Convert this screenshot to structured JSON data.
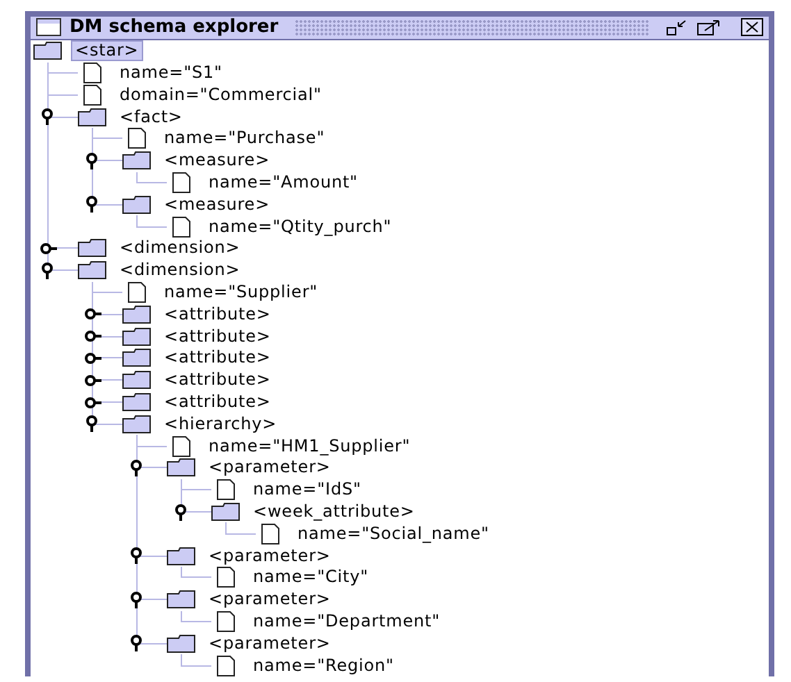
{
  "window": {
    "title": "DM schema explorer"
  },
  "tree": [
    {
      "kind": "element",
      "label": "<star>",
      "selected": true,
      "children": [
        {
          "kind": "value",
          "label": "name=\"S1\"",
          "selected": false
        },
        {
          "kind": "value",
          "label": "domain=\"Commercial\"",
          "selected": false
        },
        {
          "kind": "element",
          "label": "<fact>",
          "selected": false,
          "expanded": true,
          "children": [
            {
              "kind": "value",
              "label": "name=\"Purchase\"",
              "selected": false
            },
            {
              "kind": "element",
              "label": "<measure>",
              "selected": false,
              "expanded": true,
              "children": [
                {
                  "kind": "value",
                  "label": "name=\"Amount\"",
                  "selected": false
                }
              ]
            },
            {
              "kind": "element",
              "label": "<measure>",
              "selected": false,
              "expanded": true,
              "children": [
                {
                  "kind": "value",
                  "label": "name=\"Qtity_purch\"",
                  "selected": false
                }
              ]
            }
          ]
        },
        {
          "kind": "element",
          "label": "<dimension>",
          "selected": false,
          "expanded": false
        },
        {
          "kind": "element",
          "label": "<dimension>",
          "selected": false,
          "expanded": true,
          "children": [
            {
              "kind": "value",
              "label": "name=\"Supplier\"",
              "selected": false
            },
            {
              "kind": "element",
              "label": "<attribute>",
              "selected": false,
              "expanded": false
            },
            {
              "kind": "element",
              "label": "<attribute>",
              "selected": false,
              "expanded": false
            },
            {
              "kind": "element",
              "label": "<attribute>",
              "selected": false,
              "expanded": false
            },
            {
              "kind": "element",
              "label": "<attribute>",
              "selected": false,
              "expanded": false
            },
            {
              "kind": "element",
              "label": "<attribute>",
              "selected": false,
              "expanded": false
            },
            {
              "kind": "element",
              "label": "<hierarchy>",
              "selected": false,
              "expanded": true,
              "children": [
                {
                  "kind": "value",
                  "label": "name=\"HM1_Supplier\"",
                  "selected": false
                },
                {
                  "kind": "element",
                  "label": "<parameter>",
                  "selected": false,
                  "expanded": true,
                  "children": [
                    {
                      "kind": "value",
                      "label": "name=\"IdS\"",
                      "selected": false
                    },
                    {
                      "kind": "element",
                      "label": "<week_attribute>",
                      "selected": false,
                      "expanded": true,
                      "children": [
                        {
                          "kind": "value",
                          "label": "name=\"Social_name\"",
                          "selected": false
                        }
                      ]
                    }
                  ]
                },
                {
                  "kind": "element",
                  "label": "<parameter>",
                  "selected": false,
                  "expanded": true,
                  "children": [
                    {
                      "kind": "value",
                      "label": "name=\"City\"",
                      "selected": false
                    }
                  ]
                },
                {
                  "kind": "element",
                  "label": "<parameter>",
                  "selected": false,
                  "expanded": true,
                  "children": [
                    {
                      "kind": "value",
                      "label": "name=\"Department\"",
                      "selected": false
                    }
                  ]
                },
                {
                  "kind": "element",
                  "label": "<parameter>",
                  "selected": false,
                  "expanded": true,
                  "children": [
                    {
                      "kind": "value",
                      "label": "name=\"Region\"",
                      "selected": false
                    }
                  ]
                }
              ]
            }
          ]
        }
      ]
    }
  ]
}
